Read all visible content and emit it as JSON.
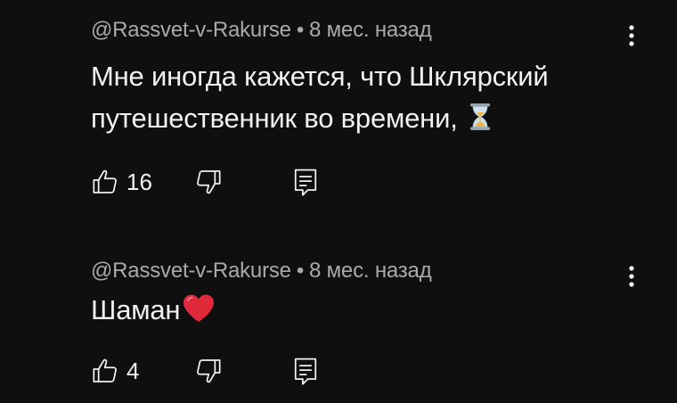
{
  "comments": [
    {
      "author": "@Rassvet-v-Rakurse",
      "separator": "•",
      "time": "8 мес. назад",
      "text": "Мне иногда кажется, что Шклярский путешественник во времени,",
      "emoji": "hourglass-icon",
      "likes": "16"
    },
    {
      "author": "@Rassvet-v-Rakurse",
      "separator": "•",
      "time": "8 мес. назад",
      "text": "Шаман",
      "emoji": "red-heart-icon",
      "likes": "4"
    }
  ],
  "colors": {
    "background": "#0f0f0f",
    "text": "#f1f1f1",
    "meta": "#aaaaaa",
    "heart": "#e0293a"
  }
}
